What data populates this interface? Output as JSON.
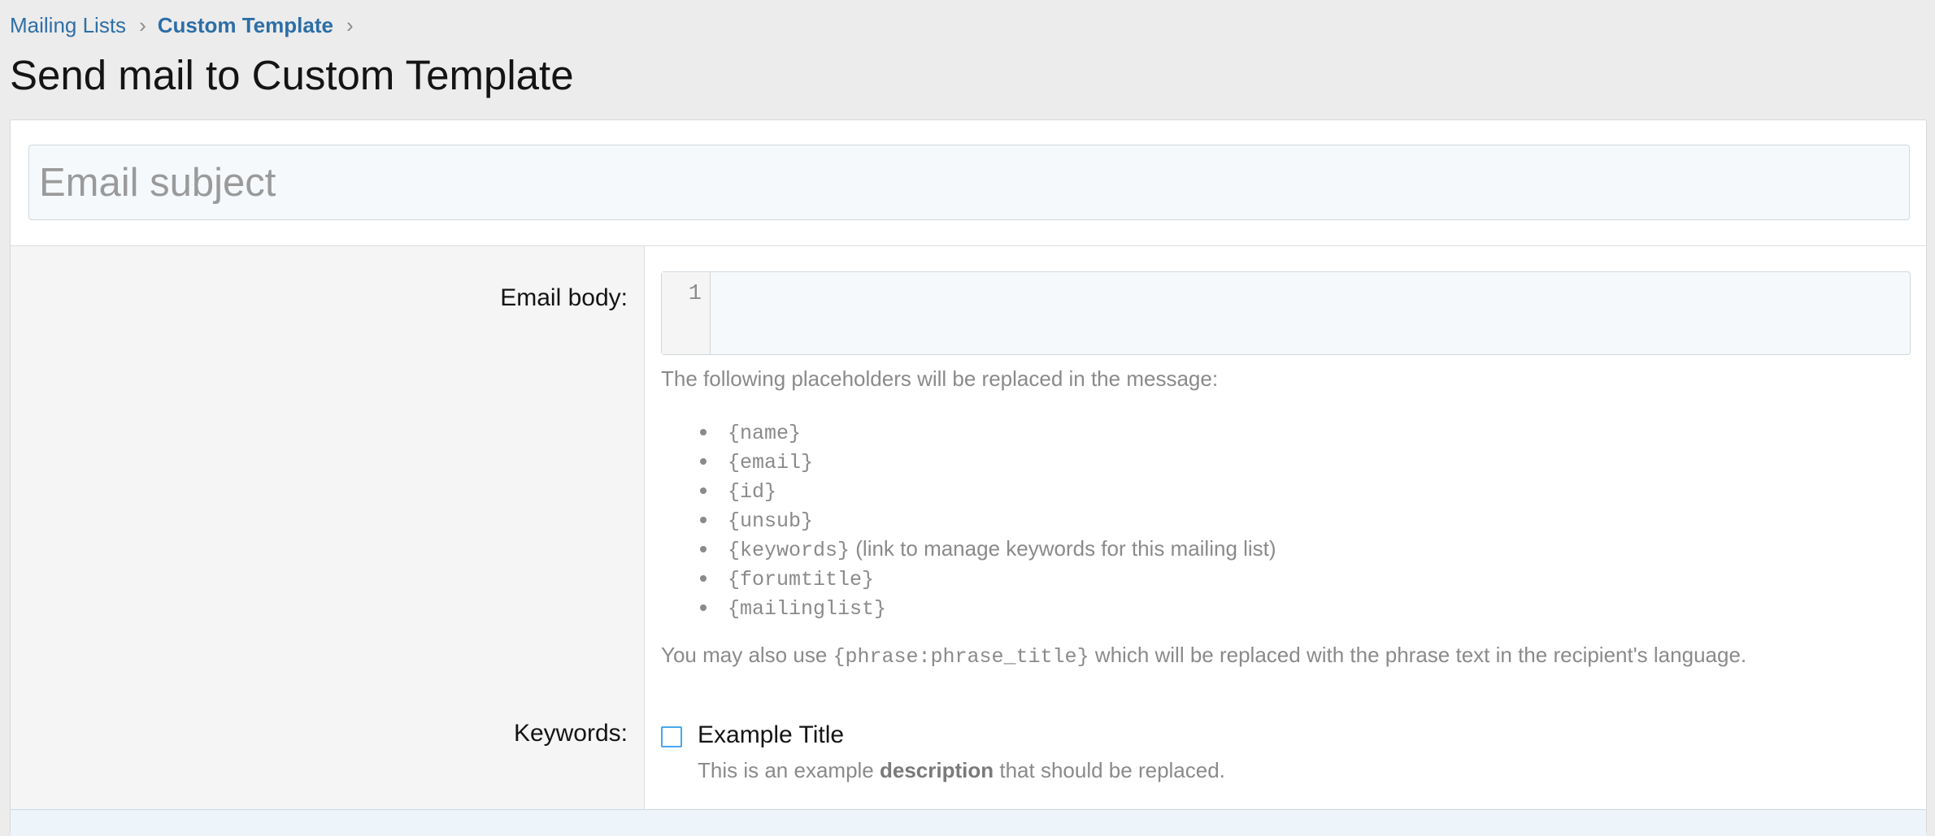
{
  "breadcrumb": {
    "items": [
      "Mailing Lists",
      "Custom Template"
    ],
    "separator": "›"
  },
  "page": {
    "title": "Send mail to Custom Template"
  },
  "subject": {
    "placeholder": "Email subject",
    "value": ""
  },
  "body": {
    "label": "Email body:",
    "line_numbers": [
      "1"
    ],
    "value": "",
    "placeholders_intro": "The following placeholders will be replaced in the message:",
    "placeholders": [
      {
        "code": "{name}",
        "note": ""
      },
      {
        "code": "{email}",
        "note": ""
      },
      {
        "code": "{id}",
        "note": ""
      },
      {
        "code": "{unsub}",
        "note": ""
      },
      {
        "code": "{keywords}",
        "note": "(link to manage keywords for this mailing list)"
      },
      {
        "code": "{forumtitle}",
        "note": ""
      },
      {
        "code": "{mailinglist}",
        "note": ""
      }
    ],
    "phrase_note": {
      "before": "You may also use",
      "code": "{phrase:phrase_title}",
      "after": "which will be replaced with the phrase text in the recipient's language."
    }
  },
  "keywords": {
    "label": "Keywords:",
    "items": [
      {
        "title": "Example Title",
        "checked": false,
        "description_before": "This is an example",
        "description_bold": "description",
        "description_after": "that should be replaced."
      }
    ]
  },
  "colors": {
    "link": "#2f6fa6",
    "checkbox_border": "#47a7eb",
    "input_background": "#f5f9fc",
    "label_column_background": "#f5f5f5",
    "muted_text": "#8a8a8a"
  }
}
